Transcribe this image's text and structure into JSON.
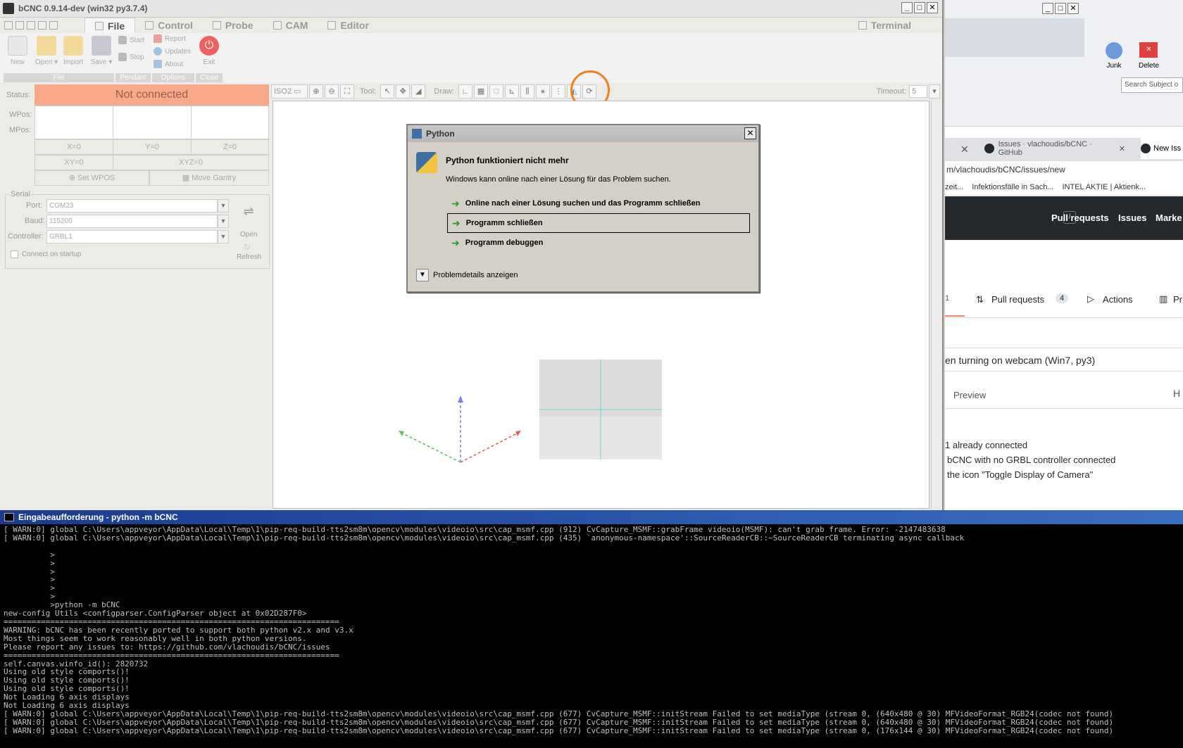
{
  "app": {
    "title": "bCNC 0.9.14-dev (win32 py3.7.4)",
    "tabs": [
      "File",
      "Control",
      "Probe",
      "CAM",
      "Editor"
    ],
    "terminal_tab": "Terminal"
  },
  "ribbon": {
    "new": "New",
    "open": "Open",
    "import": "Import",
    "save": "Save",
    "start": "Start",
    "stop": "Stop",
    "report": "Report",
    "updates": "Updates",
    "about": "About",
    "exit": "Exit",
    "groups": [
      "File",
      "Pendant",
      "Options",
      "Close"
    ]
  },
  "state": {
    "status_label": "Status:",
    "status_value": "Not connected",
    "wpos_label": "WPos:",
    "mpos_label": "MPos:",
    "x0": "X=0",
    "y0": "Y=0",
    "z0": "Z=0",
    "xy0": "XY=0",
    "xyz0": "XYZ=0",
    "set_wpos": "Set WPOS",
    "move_gantry": "Move Gantry"
  },
  "serial": {
    "legend": "Serial",
    "port_label": "Port:",
    "port_value": "COM23",
    "baud_label": "Baud:",
    "baud_value": "115200",
    "controller_label": "Controller:",
    "controller_value": "GRBL1",
    "connect_startup": "Connect on startup",
    "open": "Open",
    "refresh": "Refresh"
  },
  "canvas_toolbar": {
    "view": "ISO2",
    "tool_label": "Tool:",
    "draw_label": "Draw:",
    "timeout_label": "Timeout:",
    "timeout_value": "5"
  },
  "dialog": {
    "title": "Python",
    "heading": "Python funktioniert nicht mehr",
    "message": "Windows kann online nach einer Lösung für das Problem suchen.",
    "option1": "Online nach einer Lösung suchen und das Programm schließen",
    "option2": "Programm schließen",
    "option3": "Programm debuggen",
    "details": "Problemdetails anzeigen"
  },
  "browser": {
    "junk": "Junk",
    "delete": "Delete",
    "search_placeholder": "Search Subject o",
    "tab1": "Issues · vlachoudis/bCNC · GitHub",
    "tab2": "New Iss",
    "url": "m/vlachoudis/bCNC/issues/new",
    "bookmark1": "zeit...",
    "bookmark2": "Infektionsfälle in Sach...",
    "bookmark3": "INTEL AKTIE | Aktienk...",
    "nav_pull": "Pull requests",
    "nav_issues": "Issues",
    "nav_market": "Marke",
    "repo_issues_count": "1",
    "repo_pull": "Pull requests",
    "repo_pull_count": "4",
    "repo_actions": "Actions",
    "repo_pr": "Pr",
    "issue_title": "en turning on webcam (Win7, py3)",
    "preview": "Preview",
    "h": "H",
    "body1": "1 already connected",
    "body2": "bCNC with no GRBL controller connected",
    "body3": "the icon  \"Toggle Display of Camera\""
  },
  "console": {
    "title": "Eingabeaufforderung - python  -m bCNC",
    "lines": [
      "[ WARN:0] global C:\\Users\\appveyor\\AppData\\Local\\Temp\\1\\pip-req-build-tts2sm8m\\opencv\\modules\\videoio\\src\\cap_msmf.cpp (912) CvCapture_MSMF::grabFrame videoio(MSMF): can't grab frame. Error: -2147483638",
      "[ WARN:0] global C:\\Users\\appveyor\\AppData\\Local\\Temp\\1\\pip-req-build-tts2sm8m\\opencv\\modules\\videoio\\src\\cap_msmf.cpp (435) `anonymous-namespace'::SourceReaderCB::~SourceReaderCB terminating async callback",
      "",
      "          >",
      "          >",
      "          >",
      "          >",
      "          >",
      "          >",
      "          >python -m bCNC",
      "new-config Utils <configparser.ConfigParser object at 0x02D287F0>",
      "========================================================================",
      "WARNING: bCNC has been recently ported to support both python v2.x and v3.x",
      "Most things seem to work reasonably well in both python versions.",
      "Please report any issues to: https://github.com/vlachoudis/bCNC/issues",
      "========================================================================",
      "self.canvas.winfo_id(): 2820732",
      "Using old style comports()!",
      "Using old style comports()!",
      "Using old style comports()!",
      "Not Loading 6 axis displays",
      "Not Loading 6 axis displays",
      "[ WARN:0] global C:\\Users\\appveyor\\AppData\\Local\\Temp\\1\\pip-req-build-tts2sm8m\\opencv\\modules\\videoio\\src\\cap_msmf.cpp (677) CvCapture_MSMF::initStream Failed to set mediaType (stream 0, (640x480 @ 30) MFVideoFormat_RGB24(codec not found)",
      "[ WARN:0] global C:\\Users\\appveyor\\AppData\\Local\\Temp\\1\\pip-req-build-tts2sm8m\\opencv\\modules\\videoio\\src\\cap_msmf.cpp (677) CvCapture_MSMF::initStream Failed to set mediaType (stream 0, (640x480 @ 30) MFVideoFormat_RGB24(codec not found)",
      "[ WARN:0] global C:\\Users\\appveyor\\AppData\\Local\\Temp\\1\\pip-req-build-tts2sm8m\\opencv\\modules\\videoio\\src\\cap_msmf.cpp (677) CvCapture_MSMF::initStream Failed to set mediaType (stream 0, (176x144 @ 30) MFVideoFormat_RGB24(codec not found)"
    ]
  },
  "colors": {
    "status_bg": "#f7a98a",
    "highlight_ring": "#f08020",
    "github_header": "#24292e"
  },
  "icons": [
    "python-icon",
    "usb-icon",
    "camera-icon",
    "exit-icon",
    "close-icon"
  ]
}
